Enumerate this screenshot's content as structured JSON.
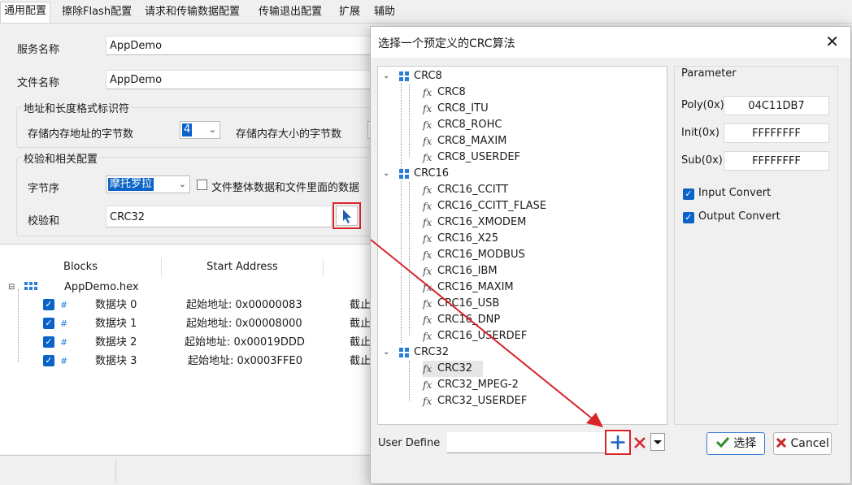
{
  "tabs": [
    "通用配置",
    "擦除Flash配置",
    "请求和传输数据配置",
    "传输退出配置",
    "扩展",
    "辅助"
  ],
  "main": {
    "service_name_label": "服务名称",
    "service_name_value": "AppDemo",
    "file_name_label": "文件名称",
    "file_name_value": "AppDemo",
    "addr_group_title": "地址和长度格式标识符",
    "addr_bytes_label": "存储内存地址的字节数",
    "addr_bytes_value": "4",
    "size_bytes_label": "存储内存大小的字节数",
    "check_group_title": "校验和相关配置",
    "byte_order_label": "字节序",
    "byte_order_value": "摩托罗拉",
    "whole_file_checkbox_label": "文件整体数据和文件里面的数据",
    "checksum_label": "校验和",
    "checksum_value": "CRC32"
  },
  "blocks": {
    "columns": [
      "Blocks",
      "Start Address"
    ],
    "root": "AppDemo.hex",
    "rows": [
      {
        "name": "数据块 0",
        "start": "起始地址: 0x00000083",
        "end": "截止"
      },
      {
        "name": "数据块 1",
        "start": "起始地址: 0x00008000",
        "end": "截止"
      },
      {
        "name": "数据块 2",
        "start": "起始地址: 0x00019DDD",
        "end": "截止"
      },
      {
        "name": "数据块 3",
        "start": "起始地址: 0x0003FFE0",
        "end": "截止"
      }
    ]
  },
  "dialog": {
    "title": "选择一个预定义的CRC算法",
    "tree": {
      "crc8": {
        "name": "CRC8",
        "items": [
          "CRC8",
          "CRC8_ITU",
          "CRC8_ROHC",
          "CRC8_MAXIM",
          "CRC8_USERDEF"
        ]
      },
      "crc16": {
        "name": "CRC16",
        "items": [
          "CRC16_CCITT",
          "CRC16_CCITT_FLASE",
          "CRC16_XMODEM",
          "CRC16_X25",
          "CRC16_MODBUS",
          "CRC16_IBM",
          "CRC16_MAXIM",
          "CRC16_USB",
          "CRC16_DNP",
          "CRC16_USERDEF"
        ]
      },
      "crc32": {
        "name": "CRC32",
        "items": [
          "CRC32",
          "CRC32_MPEG-2",
          "CRC32_USERDEF"
        ]
      }
    },
    "param": {
      "title": "Parameter",
      "poly_label": "Poly(0x)",
      "poly_value": "04C11DB7",
      "init_label": "Init(0x)",
      "init_value": "FFFFFFFF",
      "sub_label": "Sub(0x)",
      "sub_value": "FFFFFFFF",
      "input_convert": "Input Convert",
      "output_convert": "Output Convert"
    },
    "user_define_label": "User Define",
    "user_define_value": "",
    "ok_label": "选择",
    "cancel_label": "Cancel"
  },
  "colors": {
    "accent": "#0b63c7",
    "highlight": "#d9252a"
  }
}
